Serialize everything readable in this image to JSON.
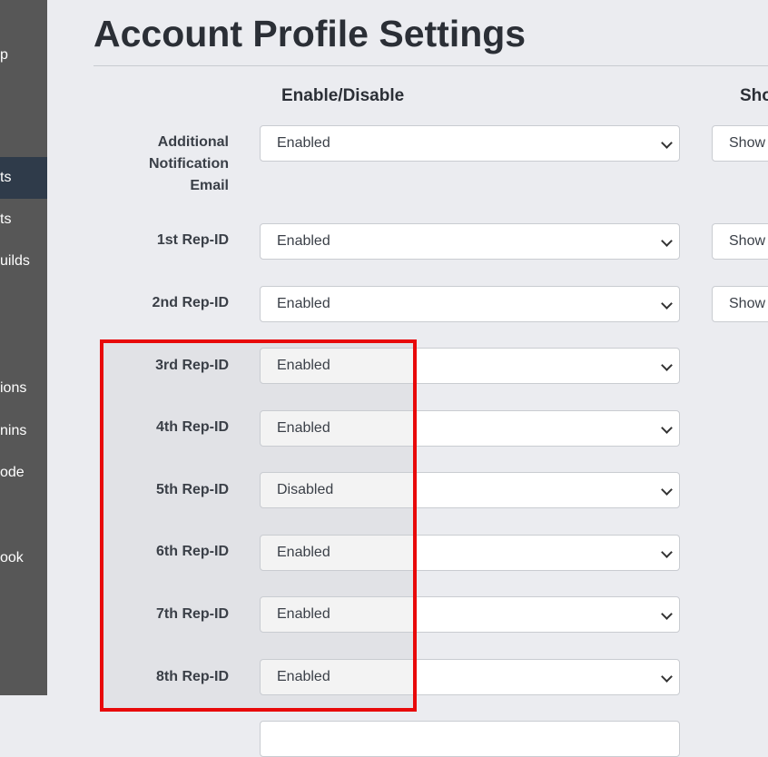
{
  "sidebar": {
    "items": [
      {
        "label": "p",
        "active": false
      },
      {
        "label": "ts",
        "active": true
      },
      {
        "label": "ts",
        "active": false
      },
      {
        "label": "uilds",
        "active": false
      },
      {
        "label": "ions",
        "active": false
      },
      {
        "label": "nins",
        "active": false
      },
      {
        "label": "ode",
        "active": false
      },
      {
        "label": "ook",
        "active": false
      }
    ]
  },
  "page": {
    "title": "Account Profile Settings",
    "col_enable": "Enable/Disable",
    "col_show": "Sho"
  },
  "rows": [
    {
      "label": "Additional\nNotification\nEmail",
      "value": "Enabled",
      "show": "Show"
    },
    {
      "label": "1st Rep-ID",
      "value": "Enabled",
      "show": "Show"
    },
    {
      "label": "2nd Rep-ID",
      "value": "Enabled",
      "show": "Show"
    },
    {
      "label": "3rd Rep-ID",
      "value": "Enabled"
    },
    {
      "label": "4th Rep-ID",
      "value": "Enabled"
    },
    {
      "label": "5th Rep-ID",
      "value": "Disabled"
    },
    {
      "label": "6th Rep-ID",
      "value": "Enabled"
    },
    {
      "label": "7th Rep-ID",
      "value": "Enabled"
    },
    {
      "label": "8th Rep-ID",
      "value": "Enabled"
    }
  ],
  "colors": {
    "highlight": "#e8090a",
    "sidebar_bg": "#575757",
    "sidebar_active": "#2f3b4a"
  }
}
